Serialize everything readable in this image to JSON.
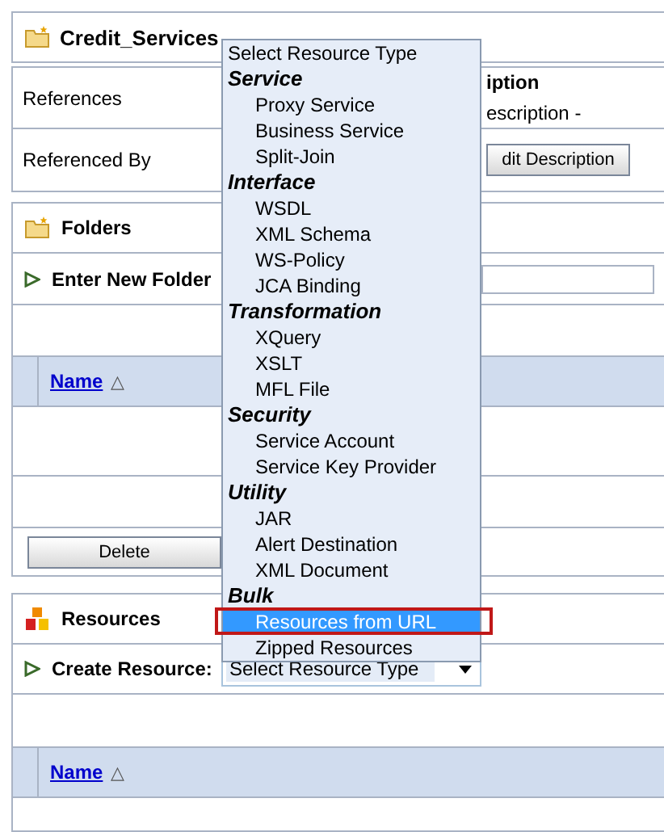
{
  "page_title": "Credit_Services",
  "properties": [
    {
      "label": "References"
    },
    {
      "label": "Referenced By"
    }
  ],
  "description": {
    "heading": "iption",
    "text": "escription -",
    "button": "dit Description"
  },
  "folders": {
    "title": "Folders",
    "enter_label": "Enter New Folder",
    "columns": [
      {
        "label": "Name",
        "sort_mark": "△"
      }
    ],
    "delete_button": "Delete"
  },
  "resources": {
    "title": "Resources",
    "create_label": "Create Resource:",
    "select_value": "Select Resource Type",
    "columns": [
      {
        "label": "Name",
        "sort_mark": "△"
      }
    ]
  },
  "dropdown": {
    "items": [
      {
        "kind": "option",
        "label": "Select Resource Type",
        "selected": false
      },
      {
        "kind": "group",
        "label": "Service"
      },
      {
        "kind": "option",
        "label": "Proxy Service",
        "selected": false
      },
      {
        "kind": "option",
        "label": "Business Service",
        "selected": false
      },
      {
        "kind": "option",
        "label": "Split-Join",
        "selected": false
      },
      {
        "kind": "group",
        "label": "Interface"
      },
      {
        "kind": "option",
        "label": "WSDL",
        "selected": false
      },
      {
        "kind": "option",
        "label": "XML Schema",
        "selected": false
      },
      {
        "kind": "option",
        "label": "WS-Policy",
        "selected": false
      },
      {
        "kind": "option",
        "label": "JCA Binding",
        "selected": false
      },
      {
        "kind": "group",
        "label": "Transformation"
      },
      {
        "kind": "option",
        "label": "XQuery",
        "selected": false
      },
      {
        "kind": "option",
        "label": "XSLT",
        "selected": false
      },
      {
        "kind": "option",
        "label": "MFL File",
        "selected": false
      },
      {
        "kind": "group",
        "label": "Security"
      },
      {
        "kind": "option",
        "label": "Service Account",
        "selected": false
      },
      {
        "kind": "option",
        "label": "Service Key Provider",
        "selected": false
      },
      {
        "kind": "group",
        "label": "Utility"
      },
      {
        "kind": "option",
        "label": "JAR",
        "selected": false
      },
      {
        "kind": "option",
        "label": "Alert Destination",
        "selected": false
      },
      {
        "kind": "option",
        "label": "XML Document",
        "selected": false
      },
      {
        "kind": "group",
        "label": "Bulk"
      },
      {
        "kind": "option",
        "label": "Resources from URL",
        "selected": true
      },
      {
        "kind": "option",
        "label": "Zipped Resources",
        "selected": false
      }
    ]
  }
}
